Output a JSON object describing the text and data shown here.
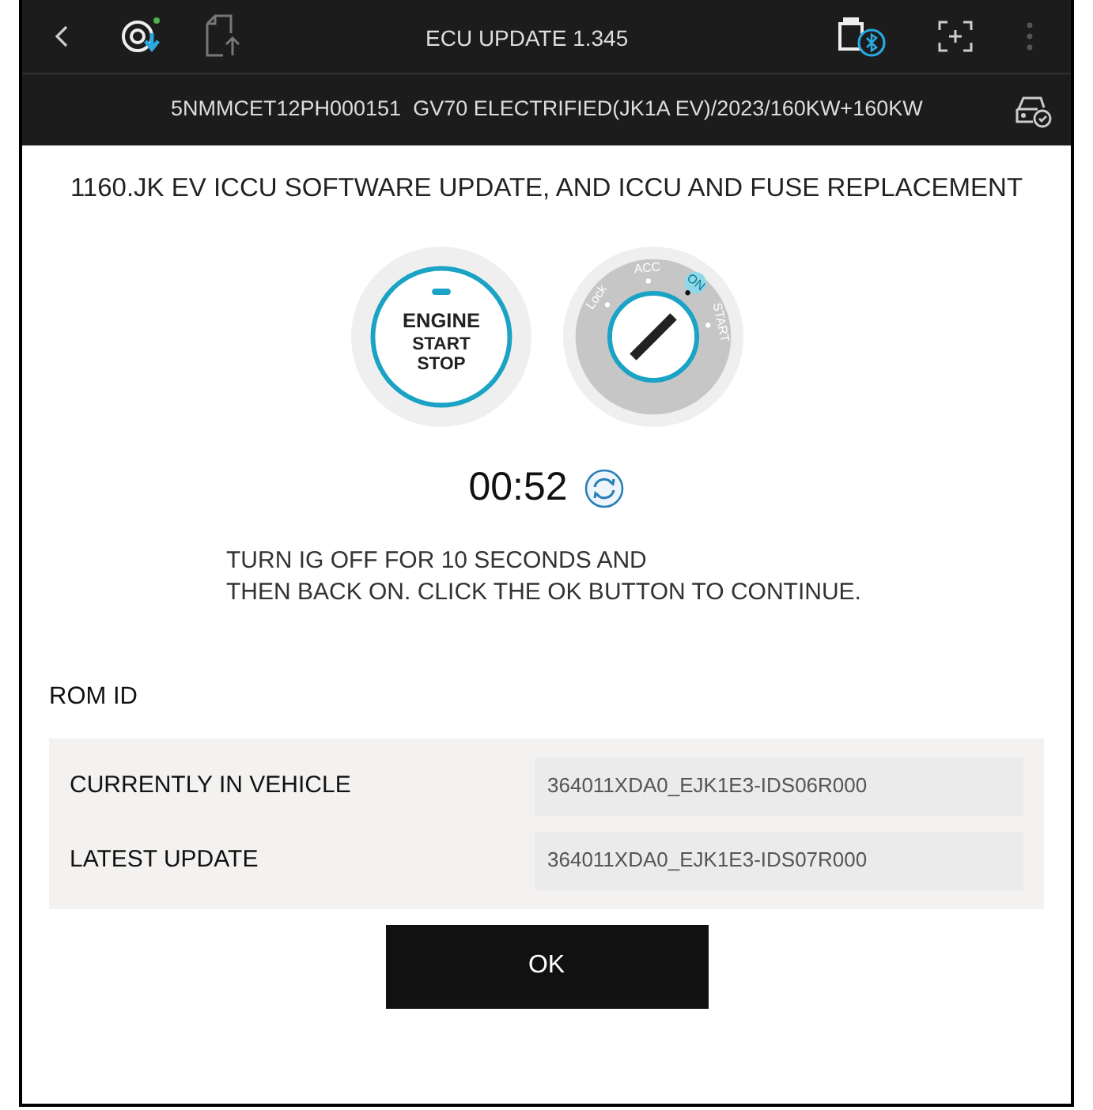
{
  "toolbar": {
    "title": "ECU UPDATE 1.345"
  },
  "vehicle_bar": {
    "text": "5NMMCET12PH000151  GV70 ELECTRIFIED(JK1A EV)/2023/160KW+160KW"
  },
  "heading": "1160.JK EV ICCU SOFTWARE UPDATE, AND ICCU AND FUSE REPLACEMENT",
  "start_button": {
    "lines": [
      "ENGINE",
      "START",
      "STOP"
    ]
  },
  "ignition": {
    "positions": [
      {
        "label": "Lock",
        "selected": false
      },
      {
        "label": "ACC",
        "selected": false
      },
      {
        "label": "ON",
        "selected": true
      },
      {
        "label": "START",
        "selected": false
      }
    ]
  },
  "timer": "00:52",
  "instructions": [
    "TURN IG OFF FOR 10 SECONDS AND",
    "THEN BACK ON. CLICK THE OK BUTTON TO CONTINUE."
  ],
  "rom_id": {
    "title": "ROM ID",
    "rows": [
      {
        "label": "CURRENTLY IN VEHICLE",
        "value": "364011XDA0_EJK1E3-IDS06R000"
      },
      {
        "label": "LATEST UPDATE",
        "value": "364011XDA0_EJK1E3-IDS07R000"
      }
    ]
  },
  "ok_button": "OK"
}
